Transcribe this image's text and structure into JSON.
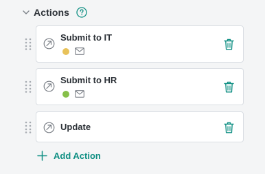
{
  "section": {
    "title": "Actions",
    "help_icon": "help-circle-icon"
  },
  "actions": [
    {
      "title": "Submit to IT",
      "status_color": "#e8c25a",
      "has_meta": true
    },
    {
      "title": "Submit to HR",
      "status_color": "#87c04a",
      "has_meta": true
    },
    {
      "title": "Update",
      "has_meta": false
    }
  ],
  "add_action_label": "Add Action",
  "colors": {
    "accent": "#0f8f83",
    "text": "#2c3137",
    "icon": "#7a7f86"
  }
}
